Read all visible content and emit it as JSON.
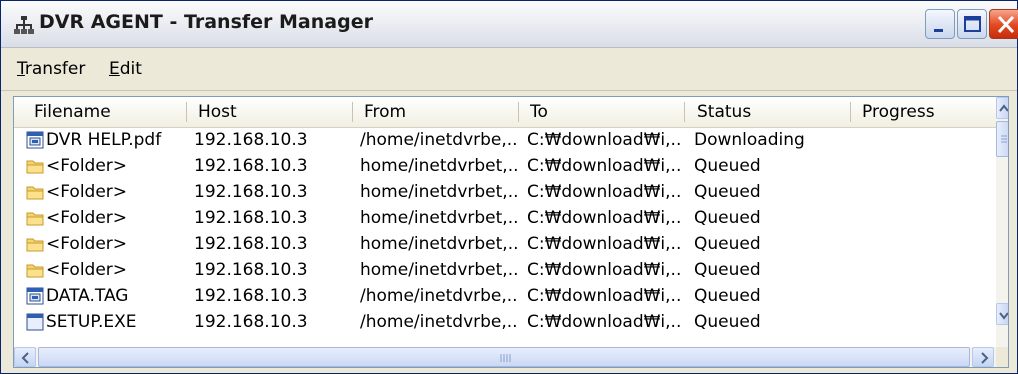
{
  "window": {
    "title": "DVR AGENT - Transfer Manager",
    "icon": "dvr-agent-app-icon"
  },
  "title_buttons": {
    "minimize_icon": "minimize-icon",
    "maximize_icon": "maximize-icon",
    "close_icon": "close-icon"
  },
  "menu": {
    "transfer": {
      "accel": "T",
      "rest": "ransfer"
    },
    "edit": {
      "accel": "E",
      "rest": "dit"
    }
  },
  "columns": [
    "Filename",
    "Host",
    "From",
    "To",
    "Status",
    "Progress"
  ],
  "rows": [
    {
      "icon": "document-icon",
      "filename": "DVR HELP.pdf",
      "host": "192.168.10.3",
      "from": "/home/inetdvrbe,..",
      "to": "C:₩download₩i,..",
      "status": "Downloading",
      "progress": ""
    },
    {
      "icon": "folder-icon",
      "filename": "<Folder>",
      "host": "192.168.10.3",
      "from": "home/inetdvrbet,..",
      "to": "C:₩download₩i,..",
      "status": "Queued",
      "progress": ""
    },
    {
      "icon": "folder-icon",
      "filename": "<Folder>",
      "host": "192.168.10.3",
      "from": "home/inetdvrbet,..",
      "to": "C:₩download₩i,..",
      "status": "Queued",
      "progress": ""
    },
    {
      "icon": "folder-icon",
      "filename": "<Folder>",
      "host": "192.168.10.3",
      "from": "home/inetdvrbet,..",
      "to": "C:₩download₩i,..",
      "status": "Queued",
      "progress": ""
    },
    {
      "icon": "folder-icon",
      "filename": "<Folder>",
      "host": "192.168.10.3",
      "from": "home/inetdvrbet,..",
      "to": "C:₩download₩i,..",
      "status": "Queued",
      "progress": ""
    },
    {
      "icon": "folder-icon",
      "filename": "<Folder>",
      "host": "192.168.10.3",
      "from": "home/inetdvrbet,..",
      "to": "C:₩download₩i,..",
      "status": "Queued",
      "progress": ""
    },
    {
      "icon": "document-icon",
      "filename": "DATA.TAG",
      "host": "192.168.10.3",
      "from": "/home/inetdvrbe,..",
      "to": "C:₩download₩i,..",
      "status": "Queued",
      "progress": ""
    },
    {
      "icon": "executable-icon",
      "filename": "SETUP.EXE",
      "host": "192.168.10.3",
      "from": "/home/inetdvrbe,..",
      "to": "C:₩download₩i,..",
      "status": "Queued",
      "progress": ""
    }
  ],
  "colors": {
    "title_bar": "#eef0f4",
    "close_button": "#e2471f",
    "folder": "#f5d46a",
    "list_border": "#7f9db9"
  }
}
